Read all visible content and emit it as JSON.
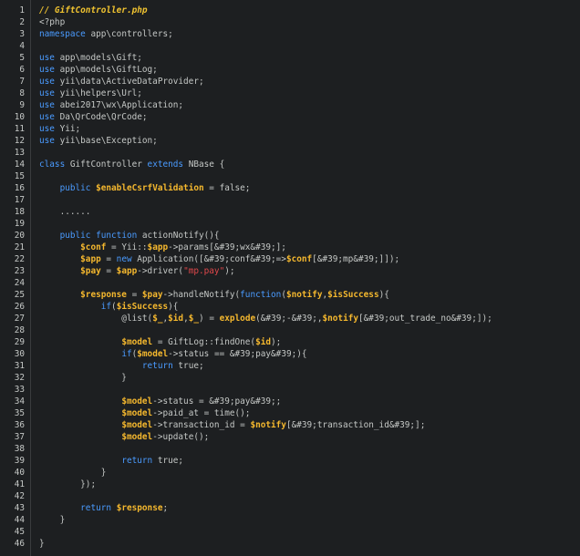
{
  "editor": {
    "lines": [
      {
        "num": "1",
        "tokens": [
          {
            "t": "// GiftController.php",
            "c": "comment"
          }
        ]
      },
      {
        "num": "2",
        "tokens": [
          {
            "t": "<?php",
            "c": "plain"
          }
        ]
      },
      {
        "num": "3",
        "tokens": [
          {
            "t": "namespace",
            "c": "kw"
          },
          {
            "t": " app\\controllers;",
            "c": "plain"
          }
        ]
      },
      {
        "num": "4",
        "tokens": []
      },
      {
        "num": "5",
        "tokens": [
          {
            "t": "use",
            "c": "kw"
          },
          {
            "t": " app\\models\\Gift;",
            "c": "plain"
          }
        ]
      },
      {
        "num": "6",
        "tokens": [
          {
            "t": "use",
            "c": "kw"
          },
          {
            "t": " app\\models\\GiftLog;",
            "c": "plain"
          }
        ]
      },
      {
        "num": "7",
        "tokens": [
          {
            "t": "use",
            "c": "kw"
          },
          {
            "t": " yii\\data\\ActiveDataProvider;",
            "c": "plain"
          }
        ]
      },
      {
        "num": "8",
        "tokens": [
          {
            "t": "use",
            "c": "kw"
          },
          {
            "t": " yii\\helpers\\Url;",
            "c": "plain"
          }
        ]
      },
      {
        "num": "9",
        "tokens": [
          {
            "t": "use",
            "c": "kw"
          },
          {
            "t": " abei2017\\wx\\Application;",
            "c": "plain"
          }
        ]
      },
      {
        "num": "10",
        "tokens": [
          {
            "t": "use",
            "c": "kw"
          },
          {
            "t": " Da\\QrCode\\QrCode;",
            "c": "plain"
          }
        ]
      },
      {
        "num": "11",
        "tokens": [
          {
            "t": "use",
            "c": "kw"
          },
          {
            "t": " Yii;",
            "c": "plain"
          }
        ]
      },
      {
        "num": "12",
        "tokens": [
          {
            "t": "use",
            "c": "kw"
          },
          {
            "t": " yii\\base\\Exception;",
            "c": "plain"
          }
        ]
      },
      {
        "num": "13",
        "tokens": []
      },
      {
        "num": "14",
        "tokens": [
          {
            "t": "class",
            "c": "kw"
          },
          {
            "t": " GiftController ",
            "c": "plain"
          },
          {
            "t": "extends",
            "c": "kw"
          },
          {
            "t": " NBase {",
            "c": "plain"
          }
        ]
      },
      {
        "num": "15",
        "tokens": []
      },
      {
        "num": "16",
        "tokens": [
          {
            "t": "    ",
            "c": "plain"
          },
          {
            "t": "public",
            "c": "kw"
          },
          {
            "t": " ",
            "c": "plain"
          },
          {
            "t": "$enableCsrfValidation",
            "c": "var"
          },
          {
            "t": " = false;",
            "c": "plain"
          }
        ]
      },
      {
        "num": "17",
        "tokens": []
      },
      {
        "num": "18",
        "tokens": [
          {
            "t": "    ......",
            "c": "plain"
          }
        ]
      },
      {
        "num": "19",
        "tokens": []
      },
      {
        "num": "20",
        "tokens": [
          {
            "t": "    ",
            "c": "plain"
          },
          {
            "t": "public",
            "c": "kw"
          },
          {
            "t": " ",
            "c": "plain"
          },
          {
            "t": "function",
            "c": "kw"
          },
          {
            "t": " actionNotify(){",
            "c": "plain"
          }
        ]
      },
      {
        "num": "21",
        "tokens": [
          {
            "t": "        ",
            "c": "plain"
          },
          {
            "t": "$conf",
            "c": "var"
          },
          {
            "t": " = Yii::",
            "c": "plain"
          },
          {
            "t": "$app",
            "c": "var"
          },
          {
            "t": "->params[&#39;wx&#39;];",
            "c": "plain"
          }
        ]
      },
      {
        "num": "22",
        "tokens": [
          {
            "t": "        ",
            "c": "plain"
          },
          {
            "t": "$app",
            "c": "var"
          },
          {
            "t": " = ",
            "c": "plain"
          },
          {
            "t": "new",
            "c": "kw"
          },
          {
            "t": " Application([&#39;conf&#39;=>",
            "c": "plain"
          },
          {
            "t": "$conf",
            "c": "var"
          },
          {
            "t": "[&#39;mp&#39;]]);",
            "c": "plain"
          }
        ]
      },
      {
        "num": "23",
        "tokens": [
          {
            "t": "        ",
            "c": "plain"
          },
          {
            "t": "$pay",
            "c": "var"
          },
          {
            "t": " = ",
            "c": "plain"
          },
          {
            "t": "$app",
            "c": "var"
          },
          {
            "t": "->driver(",
            "c": "plain"
          },
          {
            "t": "\"mp.pay\"",
            "c": "str"
          },
          {
            "t": ");",
            "c": "plain"
          }
        ]
      },
      {
        "num": "24",
        "tokens": []
      },
      {
        "num": "25",
        "tokens": [
          {
            "t": "        ",
            "c": "plain"
          },
          {
            "t": "$response",
            "c": "var"
          },
          {
            "t": " = ",
            "c": "plain"
          },
          {
            "t": "$pay",
            "c": "var"
          },
          {
            "t": "->handleNotify(",
            "c": "plain"
          },
          {
            "t": "function",
            "c": "kw"
          },
          {
            "t": "(",
            "c": "plain"
          },
          {
            "t": "$notify",
            "c": "var"
          },
          {
            "t": ",",
            "c": "plain"
          },
          {
            "t": "$isSuccess",
            "c": "var"
          },
          {
            "t": "){",
            "c": "plain"
          }
        ]
      },
      {
        "num": "26",
        "tokens": [
          {
            "t": "            ",
            "c": "plain"
          },
          {
            "t": "if",
            "c": "kw"
          },
          {
            "t": "(",
            "c": "plain"
          },
          {
            "t": "$isSuccess",
            "c": "var"
          },
          {
            "t": "){",
            "c": "plain"
          }
        ]
      },
      {
        "num": "27",
        "tokens": [
          {
            "t": "                @list(",
            "c": "plain"
          },
          {
            "t": "$_",
            "c": "var"
          },
          {
            "t": ",",
            "c": "plain"
          },
          {
            "t": "$id",
            "c": "var"
          },
          {
            "t": ",",
            "c": "plain"
          },
          {
            "t": "$_",
            "c": "var"
          },
          {
            "t": ") = ",
            "c": "plain"
          },
          {
            "t": "explode",
            "c": "var"
          },
          {
            "t": "(&#39;-&#39;,",
            "c": "plain"
          },
          {
            "t": "$notify",
            "c": "var"
          },
          {
            "t": "[&#39;out_trade_no&#39;]);",
            "c": "plain"
          }
        ]
      },
      {
        "num": "28",
        "tokens": []
      },
      {
        "num": "29",
        "tokens": [
          {
            "t": "                ",
            "c": "plain"
          },
          {
            "t": "$model",
            "c": "var"
          },
          {
            "t": " = GiftLog::findOne(",
            "c": "plain"
          },
          {
            "t": "$id",
            "c": "var"
          },
          {
            "t": ");",
            "c": "plain"
          }
        ]
      },
      {
        "num": "30",
        "tokens": [
          {
            "t": "                ",
            "c": "plain"
          },
          {
            "t": "if",
            "c": "kw"
          },
          {
            "t": "(",
            "c": "plain"
          },
          {
            "t": "$model",
            "c": "var"
          },
          {
            "t": "->status == &#39;pay&#39;){",
            "c": "plain"
          }
        ]
      },
      {
        "num": "31",
        "tokens": [
          {
            "t": "                    ",
            "c": "plain"
          },
          {
            "t": "return",
            "c": "kw"
          },
          {
            "t": " true;",
            "c": "plain"
          }
        ]
      },
      {
        "num": "32",
        "tokens": [
          {
            "t": "                }",
            "c": "plain"
          }
        ]
      },
      {
        "num": "33",
        "tokens": []
      },
      {
        "num": "34",
        "tokens": [
          {
            "t": "                ",
            "c": "plain"
          },
          {
            "t": "$model",
            "c": "var"
          },
          {
            "t": "->status = &#39;pay&#39;;",
            "c": "plain"
          }
        ]
      },
      {
        "num": "35",
        "tokens": [
          {
            "t": "                ",
            "c": "plain"
          },
          {
            "t": "$model",
            "c": "var"
          },
          {
            "t": "->paid_at = time();",
            "c": "plain"
          }
        ]
      },
      {
        "num": "36",
        "tokens": [
          {
            "t": "                ",
            "c": "plain"
          },
          {
            "t": "$model",
            "c": "var"
          },
          {
            "t": "->transaction_id = ",
            "c": "plain"
          },
          {
            "t": "$notify",
            "c": "var"
          },
          {
            "t": "[&#39;transaction_id&#39;];",
            "c": "plain"
          }
        ]
      },
      {
        "num": "37",
        "tokens": [
          {
            "t": "                ",
            "c": "plain"
          },
          {
            "t": "$model",
            "c": "var"
          },
          {
            "t": "->update();",
            "c": "plain"
          }
        ]
      },
      {
        "num": "38",
        "tokens": []
      },
      {
        "num": "39",
        "tokens": [
          {
            "t": "                ",
            "c": "plain"
          },
          {
            "t": "return",
            "c": "kw"
          },
          {
            "t": " true;",
            "c": "plain"
          }
        ]
      },
      {
        "num": "40",
        "tokens": [
          {
            "t": "            }",
            "c": "plain"
          }
        ]
      },
      {
        "num": "41",
        "tokens": [
          {
            "t": "        });",
            "c": "plain"
          }
        ]
      },
      {
        "num": "42",
        "tokens": []
      },
      {
        "num": "43",
        "tokens": [
          {
            "t": "        ",
            "c": "plain"
          },
          {
            "t": "return",
            "c": "kw"
          },
          {
            "t": " ",
            "c": "plain"
          },
          {
            "t": "$response",
            "c": "var"
          },
          {
            "t": ";",
            "c": "plain"
          }
        ]
      },
      {
        "num": "44",
        "tokens": [
          {
            "t": "    }",
            "c": "plain"
          }
        ]
      },
      {
        "num": "45",
        "tokens": []
      },
      {
        "num": "46",
        "tokens": [
          {
            "t": "}",
            "c": "plain"
          }
        ]
      }
    ]
  },
  "theme": {
    "background": "#1d1f21",
    "plain": "#c5c8c6",
    "keyword": "#4a9bff",
    "variable": "#f5b82e",
    "string": "#e0474b",
    "comment": "#f0c330"
  }
}
